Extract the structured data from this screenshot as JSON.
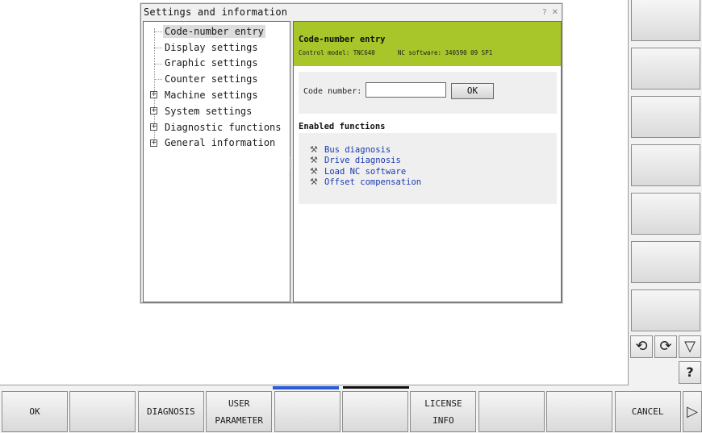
{
  "dialog": {
    "title": "Settings and information",
    "help_glyph": "?",
    "close_glyph": "✕"
  },
  "tree": {
    "items": [
      {
        "label": "Code-number entry",
        "expandable": false,
        "selected": true
      },
      {
        "label": "Display settings",
        "expandable": false,
        "selected": false
      },
      {
        "label": "Graphic settings",
        "expandable": false,
        "selected": false
      },
      {
        "label": "Counter settings",
        "expandable": false,
        "selected": false
      },
      {
        "label": "Machine settings",
        "expandable": true,
        "selected": false
      },
      {
        "label": "System settings",
        "expandable": true,
        "selected": false
      },
      {
        "label": "Diagnostic functions",
        "expandable": true,
        "selected": false
      },
      {
        "label": "General information",
        "expandable": true,
        "selected": false
      }
    ],
    "expand_glyph": "+"
  },
  "content": {
    "header_title": "Code-number entry",
    "control_model": "Control model: TNC640",
    "nc_software": "NC software: 340590 09 SP1",
    "code_label": "Code number:",
    "code_value": "",
    "ok_label": "OK",
    "enabled_title": "Enabled functions",
    "functions": [
      "Bus diagnosis",
      "Drive diagnosis",
      "Load NC software",
      "Offset compensation"
    ],
    "accent_color": "#a8c52a"
  },
  "right_keys": {
    "count": 7,
    "mini": [
      {
        "name": "rotate-left-icon",
        "glyph": "⟲"
      },
      {
        "name": "rotate-right-icon",
        "glyph": "⟳"
      },
      {
        "name": "triangle-down-icon",
        "glyph": "▽"
      },
      {
        "name": "help-icon",
        "glyph": "?"
      }
    ]
  },
  "bottom_keys": [
    {
      "line1": "OK",
      "line2": ""
    },
    {
      "line1": "",
      "line2": ""
    },
    {
      "line1": "DIAGNOSIS",
      "line2": ""
    },
    {
      "line1": "USER",
      "line2": "PARAMETER"
    },
    {
      "line1": "",
      "line2": ""
    },
    {
      "line1": "",
      "line2": ""
    },
    {
      "line1": "LICENSE",
      "line2": "INFO"
    },
    {
      "line1": "",
      "line2": ""
    },
    {
      "line1": "",
      "line2": ""
    },
    {
      "line1": "CANCEL",
      "line2": ""
    }
  ],
  "bottom_arrow_glyph": "▷",
  "tab_indicators": [
    {
      "color": "#2a5bd7"
    },
    {
      "color": "#111111"
    }
  ]
}
